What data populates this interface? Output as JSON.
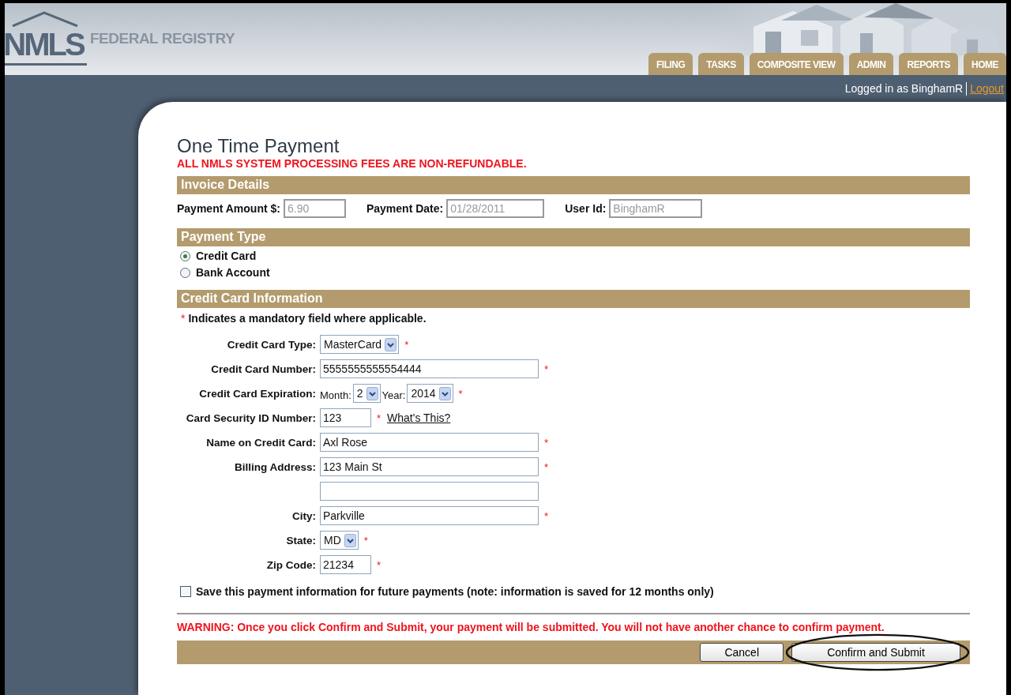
{
  "header": {
    "logo": "NMLS",
    "title": "FEDERAL REGISTRY",
    "tabs": [
      {
        "label": "FILING"
      },
      {
        "label": "TASKS"
      },
      {
        "label": "COMPOSITE VIEW"
      },
      {
        "label": "ADMIN"
      },
      {
        "label": "REPORTS"
      },
      {
        "label": "HOME"
      }
    ],
    "logged_in": "Logged in as BinghamR",
    "logout": "Logout"
  },
  "page": {
    "title": "One Time Payment",
    "notice": "ALL NMLS SYSTEM PROCESSING FEES ARE NON-REFUNDABLE."
  },
  "invoice": {
    "heading": "Invoice Details",
    "fields": [
      {
        "label": "Payment Amount $:",
        "value": "6.90",
        "disabled": true
      },
      {
        "label": "Payment Date:",
        "value": "01/28/2011",
        "disabled": true
      },
      {
        "label": "User Id:",
        "value": "BinghamR",
        "disabled": true
      }
    ]
  },
  "payment_type": {
    "heading": "Payment Type",
    "options": [
      {
        "label": "Credit Card",
        "selected": true
      },
      {
        "label": "Bank Account",
        "selected": false
      }
    ]
  },
  "credit_card": {
    "heading": "Credit Card Information",
    "mandatory_mark": "*",
    "mandatory_note": "Indicates a mandatory field where applicable.",
    "rows": [
      {
        "kind": "select",
        "label": "Credit Card Type:",
        "value": "MasterCard",
        "required": true
      },
      {
        "kind": "text",
        "label": "Credit Card Number:",
        "value": "5555555555554444",
        "required": true
      },
      {
        "kind": "expiration",
        "label": "Credit Card Expiration:",
        "parts": [
          {
            "label": "Month:",
            "value": "2"
          },
          {
            "label": "Year:",
            "value": "2014"
          }
        ],
        "required": true
      },
      {
        "kind": "short",
        "label": "Card Security ID Number:",
        "value": "123",
        "required": true,
        "link": "What's This?"
      },
      {
        "kind": "text",
        "label": "Name on Credit Card:",
        "value": "Axl Rose",
        "required": true
      },
      {
        "kind": "text",
        "label": "Billing Address:",
        "value": "123 Main St",
        "required": true
      },
      {
        "kind": "text",
        "required": false
      },
      {
        "kind": "text",
        "label": "City:",
        "value": "Parkville",
        "required": true
      },
      {
        "kind": "select",
        "label": "State:",
        "value": "MD",
        "required": true
      },
      {
        "kind": "short",
        "label": "Zip Code:",
        "value": "21234",
        "required": true
      }
    ],
    "save": {
      "label": "Save this payment information for future payments (note: information is saved for 12 months only)",
      "checked": false
    }
  },
  "warning": "WARNING: Once you click Confirm and Submit, your payment will be submitted. You will not have another chance to confirm payment.",
  "buttons": [
    {
      "label": "Cancel",
      "highlighted": false
    },
    {
      "label": "Confirm and Submit",
      "highlighted": true
    }
  ]
}
